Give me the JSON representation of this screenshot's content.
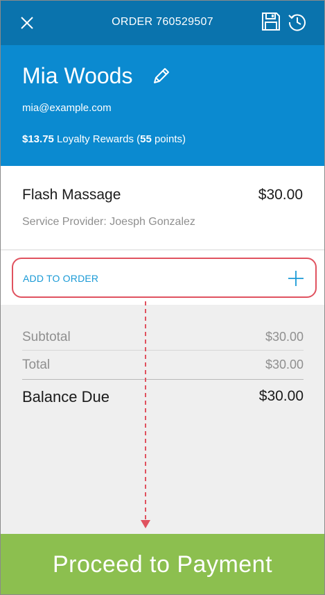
{
  "header": {
    "order_title": "ORDER 760529507",
    "close_icon": "close-icon",
    "save_icon": "save-icon",
    "history_icon": "history-icon",
    "background_color": "#0a73ad"
  },
  "customer": {
    "name": "Mia Woods",
    "email": "mia@example.com",
    "loyalty_amount": "$13.75",
    "loyalty_text": " Loyalty Rewards (",
    "loyalty_points": "55",
    "loyalty_suffix": " points)",
    "edit_icon": "pencil-icon",
    "background_color": "#0b8ad0"
  },
  "item": {
    "name": "Flash Massage",
    "price": "$30.00",
    "provider": "Service Provider: Joesph Gonzalez"
  },
  "add_to_order": {
    "label": "ADD TO ORDER",
    "icon": "plus-icon",
    "highlight_color": "#e0525f"
  },
  "totals": {
    "subtotal_label": "Subtotal",
    "subtotal_value": "$30.00",
    "total_label": "Total",
    "total_value": "$30.00",
    "balance_label": "Balance Due",
    "balance_value": "$30.00"
  },
  "proceed": {
    "label": "Proceed to Payment",
    "background_color": "#8cbf4f"
  }
}
